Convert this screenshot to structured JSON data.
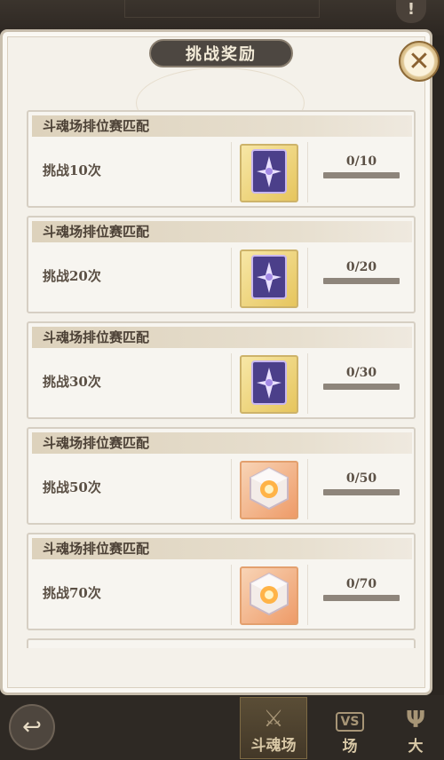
{
  "panel": {
    "title": "挑战奖励",
    "close_label": "✕",
    "info_label": "!"
  },
  "tasks": [
    {
      "category": "斗魂场排位赛匹配",
      "description": "挑战10次",
      "progress_text": "0/10",
      "progress": 0,
      "reward_icon": "soul-card-icon",
      "reward_style": "gold"
    },
    {
      "category": "斗魂场排位赛匹配",
      "description": "挑战20次",
      "progress_text": "0/20",
      "progress": 0,
      "reward_icon": "soul-card-icon",
      "reward_style": "gold"
    },
    {
      "category": "斗魂场排位赛匹配",
      "description": "挑战30次",
      "progress_text": "0/30",
      "progress": 0,
      "reward_icon": "soul-card-icon",
      "reward_style": "gold"
    },
    {
      "category": "斗魂场排位赛匹配",
      "description": "挑战50次",
      "progress_text": "0/50",
      "progress": 0,
      "reward_icon": "crystal-cube-icon",
      "reward_style": "orange"
    },
    {
      "category": "斗魂场排位赛匹配",
      "description": "挑战70次",
      "progress_text": "0/70",
      "progress": 0,
      "reward_icon": "crystal-cube-icon",
      "reward_style": "orange"
    }
  ],
  "bottom_nav": {
    "back_icon": "back-arrow-icon",
    "items": [
      {
        "label": "斗魂场",
        "icon": "crossed-swords-icon",
        "active": true
      },
      {
        "label": "场",
        "icon": "vs-icon",
        "icon_text": "VS",
        "active": false
      },
      {
        "label": "大",
        "icon": "trident-icon",
        "active": false
      }
    ]
  },
  "colors": {
    "panel_bg": "#f4f1ea",
    "header_bar": "#ddd2bc",
    "title_pill": "#4d4741",
    "progress_track": "#8e857b"
  }
}
